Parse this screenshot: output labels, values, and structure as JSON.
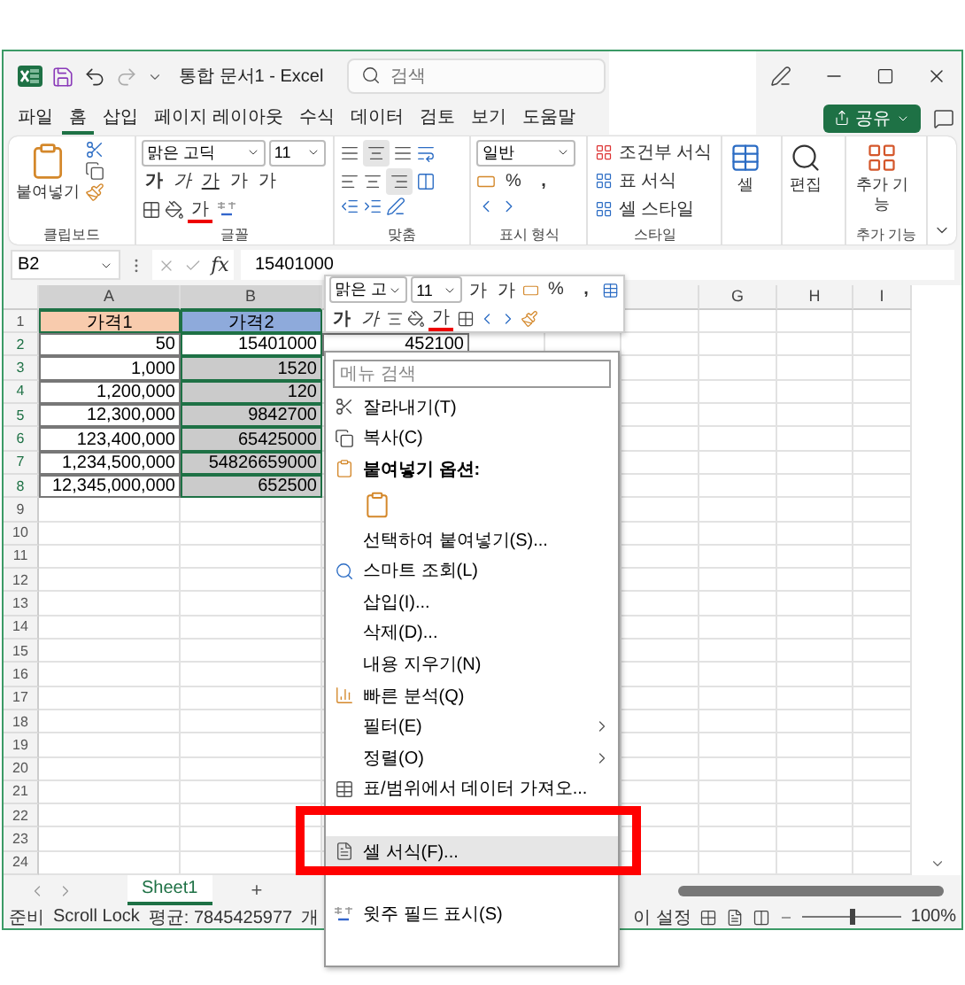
{
  "title_bar": {
    "title": "통합 문서1 - Excel",
    "search": {
      "placeholder": "검색"
    }
  },
  "menu_tabs": [
    {
      "label": "파일",
      "selected": false
    },
    {
      "label": "홈",
      "selected": true
    },
    {
      "label": "삽입",
      "selected": false
    },
    {
      "label": "페이지 레이아웃",
      "selected": false
    },
    {
      "label": "수식",
      "selected": false
    },
    {
      "label": "데이터",
      "selected": false
    },
    {
      "label": "검토",
      "selected": false
    },
    {
      "label": "보기",
      "selected": false
    },
    {
      "label": "도움말",
      "selected": false
    }
  ],
  "share_button": {
    "label": "공유"
  },
  "ribbon": {
    "clipboard": {
      "paste": "붙여넣기",
      "label": "클립보드"
    },
    "font": {
      "font_name": "맑은 고딕",
      "font_size": "11",
      "styles": [
        {
          "kind": "bold",
          "text": "가"
        },
        {
          "kind": "italic",
          "text": "가"
        },
        {
          "kind": "underline",
          "text": "가"
        }
      ],
      "grow": "가",
      "shrink": "가",
      "font_color": "가",
      "label": "글꼴"
    },
    "alignment": {
      "label": "맞춤"
    },
    "number": {
      "format": "일반",
      "percent": "%",
      "comma": ",",
      "label": "표시 형식"
    },
    "styles": {
      "items": [
        "조건부 서식",
        "표 서식",
        "셀 스타일"
      ],
      "label": "스타일"
    },
    "cells": {
      "button": "셀"
    },
    "editing": {
      "button": "편집"
    },
    "addins": {
      "button": "추가 기능",
      "label": "추가 기능"
    }
  },
  "formula_bar": {
    "name_box": "B2",
    "function_label": "fx",
    "formula": "15401000"
  },
  "column_headers_left": [
    "A",
    "B"
  ],
  "column_headers_right": [
    "G",
    "H",
    "I"
  ],
  "rows": [
    {
      "number": "1",
      "cells": [
        {
          "text": "가격1",
          "color": "#f8cbad"
        },
        {
          "text": "가격2",
          "color": "#8eaadb"
        }
      ]
    },
    {
      "number": "2",
      "cells": [
        {
          "text": "50"
        },
        {
          "text": "15401000",
          "selected": true,
          "active": true
        },
        {
          "text": "452100"
        }
      ]
    },
    {
      "number": "3",
      "cells": [
        {
          "text": "1,000"
        },
        {
          "text": "1520",
          "selected": true,
          "active": false
        }
      ]
    },
    {
      "number": "4",
      "cells": [
        {
          "text": "1,200,000"
        },
        {
          "text": "120",
          "selected": true,
          "active": false
        }
      ]
    },
    {
      "number": "5",
      "cells": [
        {
          "text": "12,300,000"
        },
        {
          "text": "9842700",
          "selected": true,
          "active": false
        }
      ]
    },
    {
      "number": "6",
      "cells": [
        {
          "text": "123,400,000"
        },
        {
          "text": "65425000",
          "selected": true,
          "active": false
        }
      ]
    },
    {
      "number": "7",
      "cells": [
        {
          "text": "1,234,500,000"
        },
        {
          "text": "54826659000",
          "selected": true,
          "active": false
        }
      ]
    },
    {
      "number": "8",
      "cells": [
        {
          "text": "12,345,000,000"
        },
        {
          "text": "652500",
          "selected": true,
          "active": false
        }
      ]
    },
    {
      "number": "9"
    },
    {
      "number": "10"
    },
    {
      "number": "11"
    },
    {
      "number": "12"
    },
    {
      "number": "13"
    },
    {
      "number": "14"
    },
    {
      "number": "15"
    },
    {
      "number": "16"
    },
    {
      "number": "17"
    },
    {
      "number": "18"
    },
    {
      "number": "19"
    },
    {
      "number": "20"
    },
    {
      "number": "21"
    },
    {
      "number": "22"
    },
    {
      "number": "23"
    },
    {
      "number": "24"
    }
  ],
  "sheet_tabs": [
    {
      "label": "Sheet1",
      "selected": true
    }
  ],
  "add_sheet": "+",
  "status_bar": {
    "items": [
      "준비",
      "Scroll Lock",
      "평균: 7845425977",
      "개"
    ],
    "right_text": "이 설정",
    "zoom": {
      "level": 0.5,
      "label": "100%"
    }
  },
  "mini_toolbar": {
    "font_name": "맑은 고",
    "font_size": "11",
    "grow": "가",
    "shrink": "가",
    "percent": "%",
    "comma": ",",
    "bold": "가",
    "italic": "가",
    "font_color": "가"
  },
  "context_menu": {
    "search": {
      "placeholder": "메뉴 검색"
    },
    "items": [
      {
        "kind": "item",
        "label": "잘라내기(T)",
        "selected": false
      },
      {
        "kind": "item",
        "label": "복사(C)",
        "selected": false
      },
      {
        "kind": "header",
        "label": "붙여넣기 옵션:",
        "selected": false
      },
      {
        "kind": "paste_options",
        "selected": false
      },
      {
        "kind": "item",
        "label": "선택하여 붙여넣기(S)...",
        "selected": false
      },
      {
        "kind": "item",
        "label": "스마트 조회(L)",
        "selected": false
      },
      {
        "kind": "item",
        "label": "삽입(I)...",
        "selected": false
      },
      {
        "kind": "item",
        "label": "삭제(D)...",
        "selected": false
      },
      {
        "kind": "item",
        "label": "내용 지우기(N)",
        "selected": false
      },
      {
        "kind": "item",
        "label": "빠른 분석(Q)",
        "selected": false
      },
      {
        "kind": "submenu",
        "label": "필터(E)",
        "selected": false
      },
      {
        "kind": "submenu",
        "label": "정렬(O)",
        "selected": false
      },
      {
        "kind": "item",
        "label": "표/범위에서 데이터 가져오...",
        "selected": false
      },
      {
        "kind": "covered",
        "selected": false
      },
      {
        "kind": "item",
        "label": "셀 서식(F)...",
        "selected": true
      },
      {
        "kind": "covered",
        "selected": false
      },
      {
        "kind": "item",
        "label": "윗주 필드 표시(S)",
        "selected": false
      },
      {
        "kind": "covered",
        "selected": false
      }
    ]
  }
}
